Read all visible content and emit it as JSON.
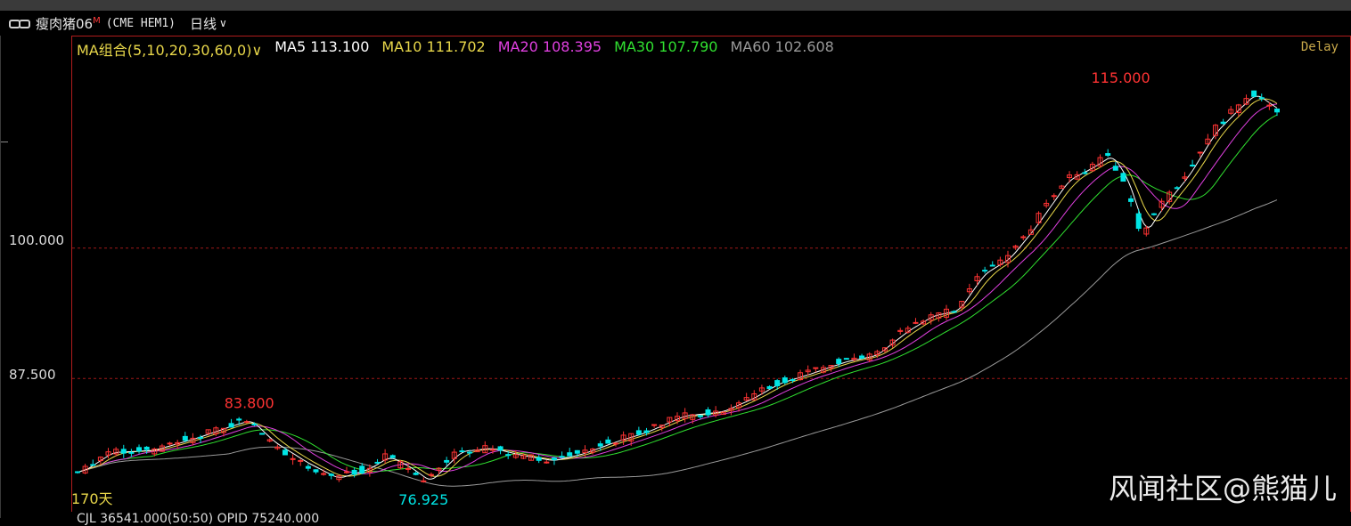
{
  "header": {
    "symbol": "瘦肉猪06",
    "symbol_mark": "M",
    "exchange": "(CME HEM1)",
    "period": "日线"
  },
  "legend": {
    "combo": "MA组合(5,10,20,30,60,0)",
    "ma5": "MA5 113.100",
    "ma10": "MA10 111.702",
    "ma20": "MA20 108.395",
    "ma30": "MA30 107.790",
    "ma60": "MA60 102.608"
  },
  "delay": "Delay",
  "watermark": "风闻社区@熊猫儿",
  "bottom_text": "CJL 36541.000(50:50) OPID 75240.000",
  "colors": {
    "up": "#ff3333",
    "down": "#00e5e5",
    "ma5": "#ffffff",
    "ma10": "#e8d74a",
    "ma20": "#e040e0",
    "ma30": "#30e030",
    "ma60": "#9a9a9a",
    "grid": "#a01818"
  },
  "chart_data": {
    "type": "candlestick",
    "y_ticks": [
      "100.000",
      "87.500"
    ],
    "bar_count_label": "170天",
    "ylim": [
      74.8,
      120.3
    ],
    "annotations": [
      {
        "text": "83.800",
        "value": 83.8,
        "bar": 67
      },
      {
        "text": "76.925",
        "value": 76.925,
        "bar": 135
      },
      {
        "text": "115.000",
        "value": 115.0,
        "bar": 407
      }
    ],
    "ma_last": {
      "MA5": 113.1,
      "MA10": 111.702,
      "MA20": 108.395,
      "MA30": 107.79,
      "MA60": 102.608
    },
    "close_anchors": [
      [
        0,
        78.5
      ],
      [
        12,
        80.4
      ],
      [
        28,
        80.6
      ],
      [
        45,
        81.8
      ],
      [
        58,
        82.9
      ],
      [
        66,
        83.5
      ],
      [
        75,
        81.4
      ],
      [
        88,
        79.4
      ],
      [
        100,
        77.9
      ],
      [
        112,
        78.8
      ],
      [
        120,
        80.0
      ],
      [
        128,
        79.0
      ],
      [
        136,
        77.6
      ],
      [
        148,
        80.5
      ],
      [
        160,
        80.8
      ],
      [
        172,
        80.1
      ],
      [
        184,
        79.6
      ],
      [
        196,
        80.3
      ],
      [
        208,
        81.4
      ],
      [
        220,
        82.3
      ],
      [
        235,
        83.9
      ],
      [
        250,
        84.3
      ],
      [
        262,
        85.6
      ],
      [
        272,
        87.0
      ],
      [
        285,
        88.0
      ],
      [
        298,
        89.1
      ],
      [
        310,
        89.7
      ],
      [
        322,
        92.0
      ],
      [
        332,
        93.5
      ],
      [
        342,
        94.0
      ],
      [
        352,
        97.5
      ],
      [
        362,
        99.0
      ],
      [
        372,
        102.0
      ],
      [
        385,
        106.5
      ],
      [
        395,
        107.8
      ],
      [
        402,
        108.9
      ],
      [
        408,
        106.6
      ],
      [
        415,
        101.4
      ],
      [
        422,
        104.0
      ],
      [
        432,
        107.0
      ],
      [
        442,
        111.0
      ],
      [
        450,
        113.0
      ],
      [
        458,
        114.8
      ],
      [
        468,
        113.1
      ]
    ]
  }
}
